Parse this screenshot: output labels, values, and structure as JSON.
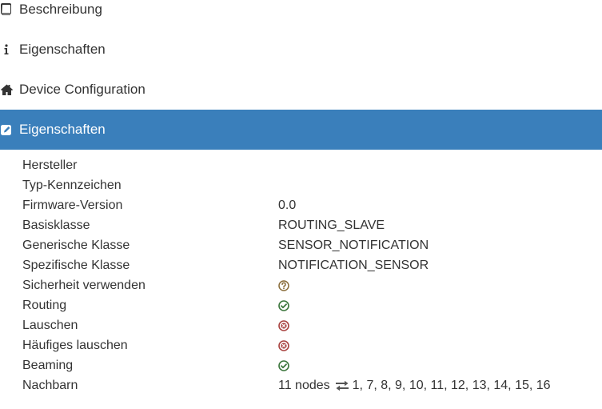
{
  "nav": {
    "items": [
      {
        "label": "Beschreibung",
        "icon": "book-icon"
      },
      {
        "label": "Eigenschaften",
        "icon": "info-icon"
      },
      {
        "label": "Device Configuration",
        "icon": "home-icon"
      },
      {
        "label": "Eigenschaften",
        "icon": "edit-icon",
        "active": true
      }
    ]
  },
  "colors": {
    "accent": "#3a7fbb",
    "ok": "#3c763d",
    "error": "#a94442",
    "unknown": "#8a6d3b"
  },
  "properties": {
    "hersteller": {
      "label": "Hersteller",
      "value": ""
    },
    "typ": {
      "label": "Typ-Kennzeichen",
      "value": ""
    },
    "firmware": {
      "label": "Firmware-Version",
      "value": "0.0"
    },
    "basisklasse": {
      "label": "Basisklasse",
      "value": "ROUTING_SLAVE"
    },
    "generisch": {
      "label": "Generische Klasse",
      "value": "SENSOR_NOTIFICATION"
    },
    "spezifisch": {
      "label": "Spezifische Klasse",
      "value": "NOTIFICATION_SENSOR"
    },
    "sicherheit": {
      "label": "Sicherheit verwenden",
      "status": "unknown",
      "icon": "question-circle-icon"
    },
    "routing": {
      "label": "Routing",
      "status": "yes",
      "icon": "check-circle-icon"
    },
    "lauschen": {
      "label": "Lauschen",
      "status": "no",
      "icon": "times-circle-icon"
    },
    "haeufig": {
      "label": "Häufiges lauschen",
      "status": "no",
      "icon": "times-circle-icon"
    },
    "beaming": {
      "label": "Beaming",
      "status": "yes",
      "icon": "check-circle-icon"
    },
    "nachbarn": {
      "label": "Nachbarn",
      "count_text": "11 nodes",
      "list": "1, 7, 8, 9, 10, 11, 12, 13, 14, 15, 16",
      "icon": "exchange-arrows-icon"
    }
  }
}
